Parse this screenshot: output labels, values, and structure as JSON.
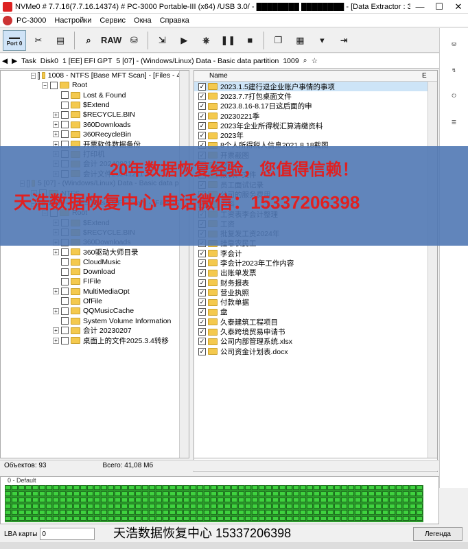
{
  "titlebar": {
    "title": "NVMe0 # 7.7.16(7.7.16.14374) # PC-3000 Portable-III (x64) /USB 3.0/ - ████████ ████████ - [Data Extractor : Задача - ...",
    "min": "—",
    "max": "☐",
    "close": "✕"
  },
  "menubar": {
    "items": [
      "PC-3000",
      "Настройки",
      "Сервис",
      "Окна",
      "Справка"
    ]
  },
  "toolbar": {
    "port_label": "Port 0",
    "raw_label": "RAW"
  },
  "pathbar": {
    "segments": [
      "Task",
      "Disk0",
      "1 [EE] EFI GPT",
      "5 [07] - (Windows/Linux) Data - Basic data partition",
      "1009"
    ]
  },
  "tree": {
    "rows": [
      {
        "indent": 44,
        "exp": "−",
        "text": "1008 - NTFS [Base MFT Scan] - [Files - 495"
      },
      {
        "indent": 60,
        "exp": "−",
        "text": "Root"
      },
      {
        "indent": 76,
        "exp": "",
        "text": "Lost & Found"
      },
      {
        "indent": 76,
        "exp": "",
        "text": "$Extend"
      },
      {
        "indent": 76,
        "exp": "+",
        "text": "$RECYCLE.BIN"
      },
      {
        "indent": 76,
        "exp": "+",
        "text": "360Downloads"
      },
      {
        "indent": 76,
        "exp": "+",
        "text": "360RecycleBin"
      },
      {
        "indent": 76,
        "exp": "+",
        "text": "开票软件数据备份"
      },
      {
        "indent": 76,
        "exp": "+",
        "text": "打印机"
      },
      {
        "indent": 76,
        "exp": "+",
        "text": "会计 20240821"
      },
      {
        "indent": 76,
        "exp": "+",
        "text": "会计文件20241211"
      },
      {
        "indent": 28,
        "exp": "−",
        "text": "5 [07] - (Windows/Linux) Data - Basic data parti"
      },
      {
        "indent": 44,
        "exp": "+",
        "text": "NTFS"
      },
      {
        "indent": 44,
        "exp": "−",
        "text": "1009 - NTFS [Base MFT Scan] - [Files - 742"
      },
      {
        "indent": 60,
        "exp": "−",
        "text": "Root"
      },
      {
        "indent": 76,
        "exp": "+",
        "text": "$Extend"
      },
      {
        "indent": 76,
        "exp": "+",
        "text": "$RECYCLE.BIN"
      },
      {
        "indent": 76,
        "exp": "+",
        "text": "360Downloads"
      },
      {
        "indent": 76,
        "exp": "+",
        "text": "360驱动大师目录"
      },
      {
        "indent": 76,
        "exp": "",
        "text": "CloudMusic"
      },
      {
        "indent": 76,
        "exp": "",
        "text": "Download"
      },
      {
        "indent": 76,
        "exp": "",
        "text": "FIFile"
      },
      {
        "indent": 76,
        "exp": "+",
        "text": "MultiMediaOpt"
      },
      {
        "indent": 76,
        "exp": "",
        "text": "OfFile"
      },
      {
        "indent": 76,
        "exp": "+",
        "text": "QQMusicCache"
      },
      {
        "indent": 76,
        "exp": "",
        "text": "System Volume Information"
      },
      {
        "indent": 76,
        "exp": "+",
        "text": "会计 20230207"
      },
      {
        "indent": 76,
        "exp": "+",
        "text": "桌面上的文件2025.3.4转移"
      }
    ]
  },
  "list": {
    "col_name": "Name",
    "col_ext": "E",
    "rows": [
      "2023.1.5建行退企业账户事情的事项",
      "2023.7.7打包桌面文件",
      "2023.8.16-8.17日这后面的申",
      "20230221季",
      "2023年企业所得税汇算清缴资料",
      "2023年",
      "8个人所得税人信息2021.8.18截图",
      "开票截图",
      "财务",
      "报销、文件",
      "员工面试记录",
      "公司的服务费用",
      "资料",
      "工资表李会计整理",
      "工资",
      "批复发工资2024年",
      "挂靠农民工",
      "李会计",
      "李会计2023年工作内容",
      "出账单发票",
      "财务报表",
      "营业执照",
      "付款单据",
      "盘",
      "久泰建筑工程项目",
      "久泰跨境贸易申请书",
      "公司内部管理系统.xlsx",
      "公司资金计划表.docx"
    ]
  },
  "status": {
    "objects": "Объектов: 93",
    "total": "Всего: 41,08 Мб"
  },
  "map": {
    "label": "0 - Default"
  },
  "bottom": {
    "lba_label": "LBA карты",
    "lba_value": "0",
    "legend_btn": "Легенда"
  },
  "overlay": {
    "line1": "20年数据恢复经验，您值得信赖！",
    "line2": "天浩数据恢复中心      电话微信：15337206398"
  },
  "watermark": "天浩数据恢复中心  15337206398"
}
